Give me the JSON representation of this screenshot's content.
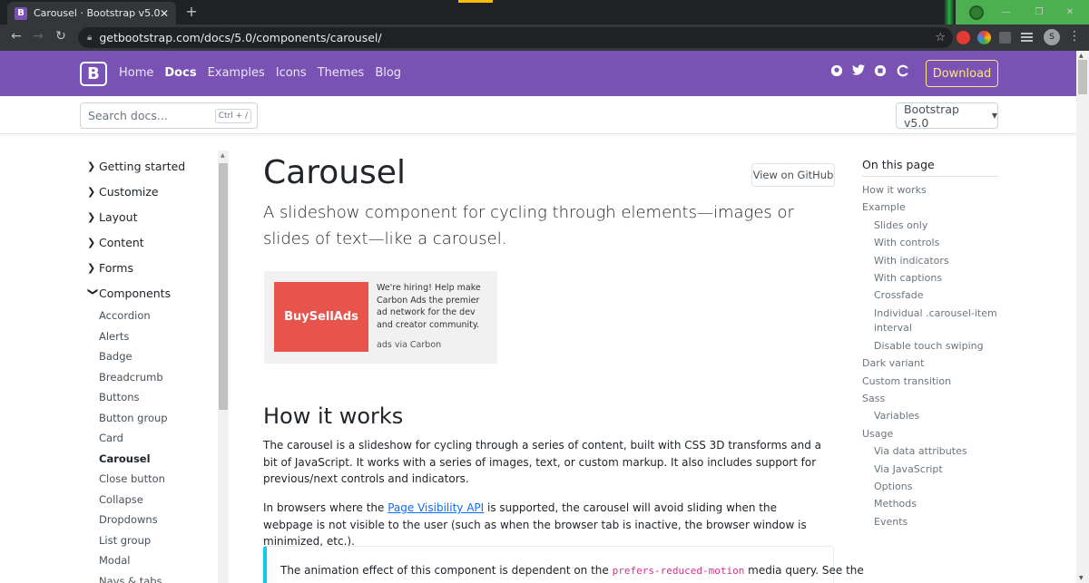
{
  "browser": {
    "tab_title": "Carousel · Bootstrap v5.0",
    "tab_favicon": "B",
    "url": "getbootstrap.com/docs/5.0/components/carousel/",
    "avatar_letter": "S"
  },
  "navbar": {
    "logo": "B",
    "links": [
      "Home",
      "Docs",
      "Examples",
      "Icons",
      "Themes",
      "Blog"
    ],
    "download_label": "Download"
  },
  "subnav": {
    "search_placeholder": "Search docs...",
    "search_shortcut": "Ctrl + /",
    "version_label": "Bootstrap v5.0"
  },
  "sidebar": {
    "groups": [
      "Getting started",
      "Customize",
      "Layout",
      "Content",
      "Forms",
      "Components"
    ],
    "components": [
      "Accordion",
      "Alerts",
      "Badge",
      "Breadcrumb",
      "Buttons",
      "Button group",
      "Card",
      "Carousel",
      "Close button",
      "Collapse",
      "Dropdowns",
      "List group",
      "Modal",
      "Navs & tabs"
    ]
  },
  "main": {
    "title": "Carousel",
    "github_label": "View on GitHub",
    "lead": "A slideshow component for cycling through elements—images or slides of text—like a carousel.",
    "ad": {
      "brand": "BuySellAds",
      "text": "We're hiring! Help make Carbon Ads the premier ad network for the dev and creator community.",
      "via": "ads via Carbon"
    },
    "section_title": "How it works",
    "para1": "The carousel is a slideshow for cycling through a series of content, built with CSS 3D transforms and a bit of JavaScript. It works with a series of images, text, or custom markup. It also includes support for previous/next controls and indicators.",
    "para2_pre": "In browsers where the ",
    "para2_link": "Page Visibility API",
    "para2_post": " is supported, the carousel will avoid sliding when the webpage is not visible to the user (such as when the browser tab is inactive, the browser window is minimized, etc.).",
    "callout_pre": "The animation effect of this component is dependent on the ",
    "callout_code": "prefers-reduced-motion",
    "callout_post": " media query. See the"
  },
  "toc": {
    "title": "On this page",
    "items": [
      {
        "label": "How it works",
        "level": 1
      },
      {
        "label": "Example",
        "level": 1
      },
      {
        "label": "Slides only",
        "level": 2
      },
      {
        "label": "With controls",
        "level": 2
      },
      {
        "label": "With indicators",
        "level": 2
      },
      {
        "label": "With captions",
        "level": 2
      },
      {
        "label": "Crossfade",
        "level": 2
      },
      {
        "label": "Individual .carousel-item interval",
        "level": 2
      },
      {
        "label": "Disable touch swiping",
        "level": 2
      },
      {
        "label": "Dark variant",
        "level": 1
      },
      {
        "label": "Custom transition",
        "level": 1
      },
      {
        "label": "Sass",
        "level": 1
      },
      {
        "label": "Variables",
        "level": 2
      },
      {
        "label": "Usage",
        "level": 1
      },
      {
        "label": "Via data attributes",
        "level": 2
      },
      {
        "label": "Via JavaScript",
        "level": 2
      },
      {
        "label": "Options",
        "level": 2
      },
      {
        "label": "Methods",
        "level": 2
      },
      {
        "label": "Events",
        "level": 2
      }
    ]
  },
  "colors": {
    "brand_purple": "#7952b3",
    "download_yellow": "#ffe484",
    "ad_red": "#e8534b",
    "link_blue": "#0d6efd"
  }
}
